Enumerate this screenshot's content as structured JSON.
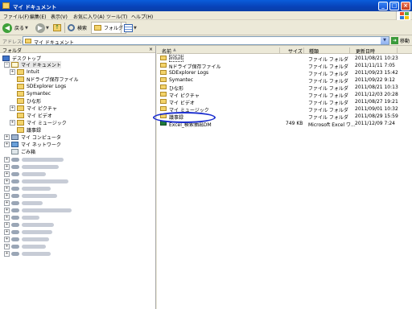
{
  "window": {
    "title": "マイ ドキュメント"
  },
  "menu": [
    "ファイル(F)",
    "編集(E)",
    "表示(V)",
    "お気に入り(A)",
    "ツール(T)",
    "ヘルプ(H)"
  ],
  "toolbar": {
    "back": "戻る",
    "search": "検索",
    "folders": "フォルダ"
  },
  "address": {
    "label": "アドレス(D)",
    "value": "マイ ドキュメント",
    "go": "移動"
  },
  "left_pane": {
    "header": "フォルダ",
    "tree": [
      {
        "label": "デスクトップ"
      },
      {
        "label": "マイ ドキュメント"
      },
      {
        "label": "Intuit"
      },
      {
        "label": "Nドライブ保存ファイル"
      },
      {
        "label": "SDExplorer Logs"
      },
      {
        "label": "Symantec"
      },
      {
        "label": "ひな形"
      },
      {
        "label": "マイ ピクチャ"
      },
      {
        "label": "マイ ビデオ"
      },
      {
        "label": "マイ ミュージック"
      },
      {
        "label": "議事録"
      },
      {
        "label": "マイ コンピュータ"
      },
      {
        "label": "マイ ネットワーク"
      },
      {
        "label": "ごみ箱"
      }
    ]
  },
  "columns": {
    "name": "名前",
    "size": "サイズ",
    "type": "種類",
    "modified": "更新日時"
  },
  "files": [
    {
      "name": "Intuit",
      "size": "",
      "type": "ファイル フォルダ",
      "modified": "2011/08/21 10:23",
      "icon": "folder-icon"
    },
    {
      "name": "Nドライブ保存ファイル",
      "size": "",
      "type": "ファイル フォルダ",
      "modified": "2011/11/11 7:05",
      "icon": "folder-icon"
    },
    {
      "name": "SDExplorer Logs",
      "size": "",
      "type": "ファイル フォルダ",
      "modified": "2011/09/23 15:42",
      "icon": "folder-icon"
    },
    {
      "name": "Symantec",
      "size": "",
      "type": "ファイル フォルダ",
      "modified": "2011/09/22 9:12",
      "icon": "folder-icon"
    },
    {
      "name": "ひな形",
      "size": "",
      "type": "ファイル フォルダ",
      "modified": "2011/08/21 10:13",
      "icon": "folder-icon"
    },
    {
      "name": "マイ ピクチャ",
      "size": "",
      "type": "ファイル フォルダ",
      "modified": "2011/12/03 20:28",
      "icon": "folder-icon"
    },
    {
      "name": "マイ ビデオ",
      "size": "",
      "type": "ファイル フォルダ",
      "modified": "2011/08/27 19:21",
      "icon": "folder-icon"
    },
    {
      "name": "マイ ミュージック",
      "size": "",
      "type": "ファイル フォルダ",
      "modified": "2011/09/01 10:32",
      "icon": "folder-icon"
    },
    {
      "name": "議事録",
      "size": "",
      "type": "ファイル フォルダ",
      "modified": "2011/08/29 15:59",
      "icon": "folder-icon"
    },
    {
      "name": "Excel_検索抽出DM",
      "size": "749 KB",
      "type": "Microsoft Excel ワ...",
      "modified": "2011/12/09 7:24",
      "icon": "excel-file-icon"
    }
  ]
}
